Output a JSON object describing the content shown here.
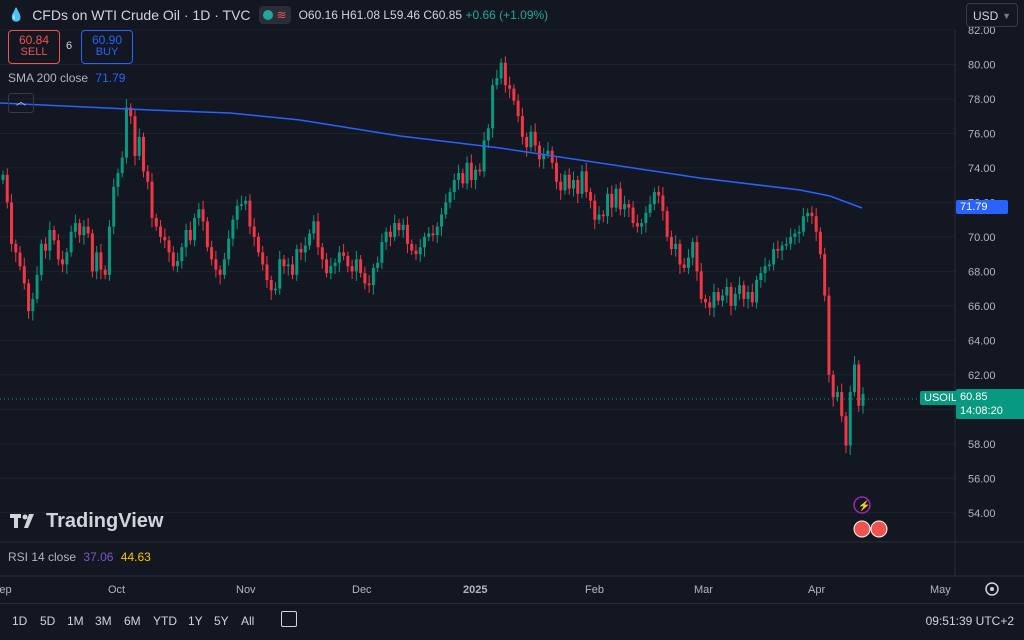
{
  "header": {
    "title": "CFDs on WTI Crude Oil · 1D · TVC",
    "open": "O60.16",
    "high": "H61.08",
    "low": "L59.46",
    "close": "C60.85",
    "change": "+0.66 (+1.09%)"
  },
  "trade": {
    "sell_price": "60.84",
    "sell_label": "SELL",
    "spread": "6",
    "buy_price": "60.90",
    "buy_label": "BUY"
  },
  "indicators": {
    "sma_label": "SMA 200 close",
    "sma_value": "71.79",
    "rsi_label": "RSI 14 close",
    "rsi_value_1": "37.06",
    "rsi_value_2": "44.63"
  },
  "currency": "USD",
  "price_scale": {
    "symbol": "USOIL",
    "last_price": "60.85",
    "countdown": "14:08:20",
    "sma_tag": "71.79"
  },
  "logo": "TradingView",
  "timeframes": [
    "1D",
    "5D",
    "1M",
    "3M",
    "6M",
    "YTD",
    "1Y",
    "5Y",
    "All"
  ],
  "clock": "09:51:39 UTC+2",
  "colors": {
    "up": "#089981",
    "down": "#f23645",
    "sma": "#2962ff",
    "bg": "#131722"
  },
  "chart_data": {
    "type": "candlestick",
    "y_ticks": [
      54,
      56,
      58,
      60,
      62,
      64,
      66,
      68,
      70,
      72,
      74,
      76,
      78,
      80,
      82
    ],
    "y_range": [
      53,
      82
    ],
    "x_labels": [
      "Sep",
      "Oct",
      "Nov",
      "Dec",
      "2025",
      "Feb",
      "Mar",
      "Apr",
      "May"
    ],
    "closes": [
      73.6,
      72.0,
      69.6,
      69.1,
      68.3,
      67.3,
      65.7,
      66.4,
      67.8,
      69.6,
      69.2,
      70.4,
      69.8,
      68.7,
      68.4,
      69.1,
      70.3,
      70.8,
      70.1,
      70.6,
      70.2,
      68.0,
      69.1,
      68.1,
      67.8,
      70.6,
      72.9,
      73.7,
      74.6,
      77.5,
      77.0,
      74.7,
      75.8,
      73.8,
      73.2,
      71.1,
      70.6,
      70.0,
      69.8,
      69.1,
      68.3,
      68.6,
      69.4,
      70.4,
      69.8,
      71.1,
      71.6,
      70.9,
      69.4,
      68.7,
      68.1,
      67.8,
      68.7,
      69.9,
      71.0,
      71.8,
      71.9,
      72.1,
      70.6,
      70.0,
      69.1,
      68.4,
      67.5,
      66.9,
      67.0,
      68.7,
      68.3,
      68.4,
      67.8,
      69.3,
      69.1,
      69.5,
      70.2,
      70.9,
      69.4,
      68.7,
      67.9,
      68.3,
      68.5,
      69.1,
      68.9,
      68.3,
      68.0,
      68.7,
      67.9,
      67.3,
      67.2,
      68.2,
      68.5,
      69.7,
      70.3,
      70.0,
      70.8,
      70.4,
      70.7,
      69.6,
      69.2,
      69.0,
      69.4,
      70.0,
      70.2,
      70.1,
      70.6,
      71.3,
      72.0,
      72.6,
      73.3,
      73.7,
      73.1,
      74.3,
      73.3,
      73.9,
      73.8,
      75.6,
      76.3,
      78.8,
      79.2,
      80.1,
      78.8,
      78.6,
      77.9,
      77.0,
      75.8,
      75.2,
      76.1,
      75.3,
      74.5,
      74.8,
      75.0,
      74.3,
      73.2,
      72.7,
      73.6,
      72.8,
      73.3,
      72.5,
      73.8,
      72.6,
      72.1,
      71.0,
      71.3,
      71.2,
      72.5,
      71.7,
      72.8,
      71.6,
      71.9,
      71.7,
      70.8,
      70.6,
      70.8,
      71.4,
      71.9,
      72.6,
      72.4,
      71.5,
      70.0,
      69.3,
      69.6,
      68.4,
      68.2,
      68.8,
      69.7,
      68.0,
      66.4,
      66.2,
      65.9,
      66.8,
      66.3,
      66.6,
      67.1,
      66.0,
      66.7,
      67.2,
      66.4,
      66.8,
      66.2,
      67.5,
      67.9,
      68.3,
      68.4,
      69.3,
      69.2,
      69.5,
      69.6,
      70.0,
      70.2,
      70.3,
      71.2,
      71.4,
      71.2,
      70.3,
      69.0,
      66.6,
      62.0,
      60.7,
      61.0,
      59.6,
      57.9,
      61.0,
      62.6,
      60.2,
      60.9
    ]
  }
}
